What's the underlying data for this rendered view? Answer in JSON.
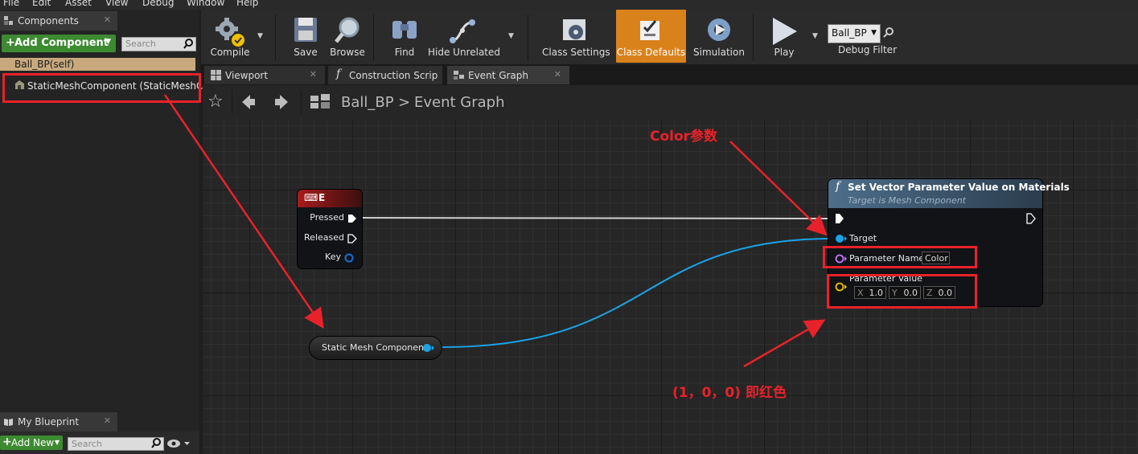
{
  "menu": [
    "File",
    "Edit",
    "Asset",
    "View",
    "Debug",
    "Window",
    "Help"
  ],
  "components_panel": {
    "tab_title": "Components",
    "add_component_label": "Add Component",
    "search_placeholder": "Search",
    "root_item": "Ball_BP(self)",
    "child_item": "StaticMeshComponent (StaticMeshCor"
  },
  "my_blueprint_panel": {
    "tab_title": "My Blueprint",
    "add_new_label": "Add New",
    "search_placeholder": "Search"
  },
  "toolbar": {
    "compile": "Compile",
    "save": "Save",
    "browse": "Browse",
    "find": "Find",
    "hide_unrelated": "Hide Unrelated",
    "class_settings": "Class Settings",
    "class_defaults": "Class Defaults",
    "simulation": "Simulation",
    "play": "Play",
    "debug_selected": "Ball_BP",
    "debug_filter": "Debug Filter"
  },
  "doc_tabs": [
    "Viewport",
    "Construction Scrip",
    "Event Graph"
  ],
  "breadcrumb": {
    "root": "Ball_BP",
    "separator": ">",
    "current": "Event Graph"
  },
  "graph": {
    "key_node": {
      "title": "E",
      "pins": [
        "Pressed",
        "Released",
        "Key"
      ]
    },
    "var_node": {
      "label": "Static Mesh Component"
    },
    "func_node": {
      "title": "Set Vector Parameter Value on Materials",
      "subtitle": "Target is Mesh Component",
      "target_label": "Target",
      "param_name_label": "Parameter Name",
      "param_name_value": "Color",
      "param_value_label": "Parameter Value",
      "x_label": "X",
      "x_value": "1.0",
      "y_label": "Y",
      "y_value": "0.0",
      "z_label": "Z",
      "z_value": "0.0"
    }
  },
  "annotations": {
    "color_param": "Color参数",
    "red_value": "(1，0，0) 即红色"
  },
  "colors": {
    "annotation_red": "#e8222a",
    "class_defaults_active": "#d9821c",
    "wire_blue": "#1aa3e8"
  }
}
